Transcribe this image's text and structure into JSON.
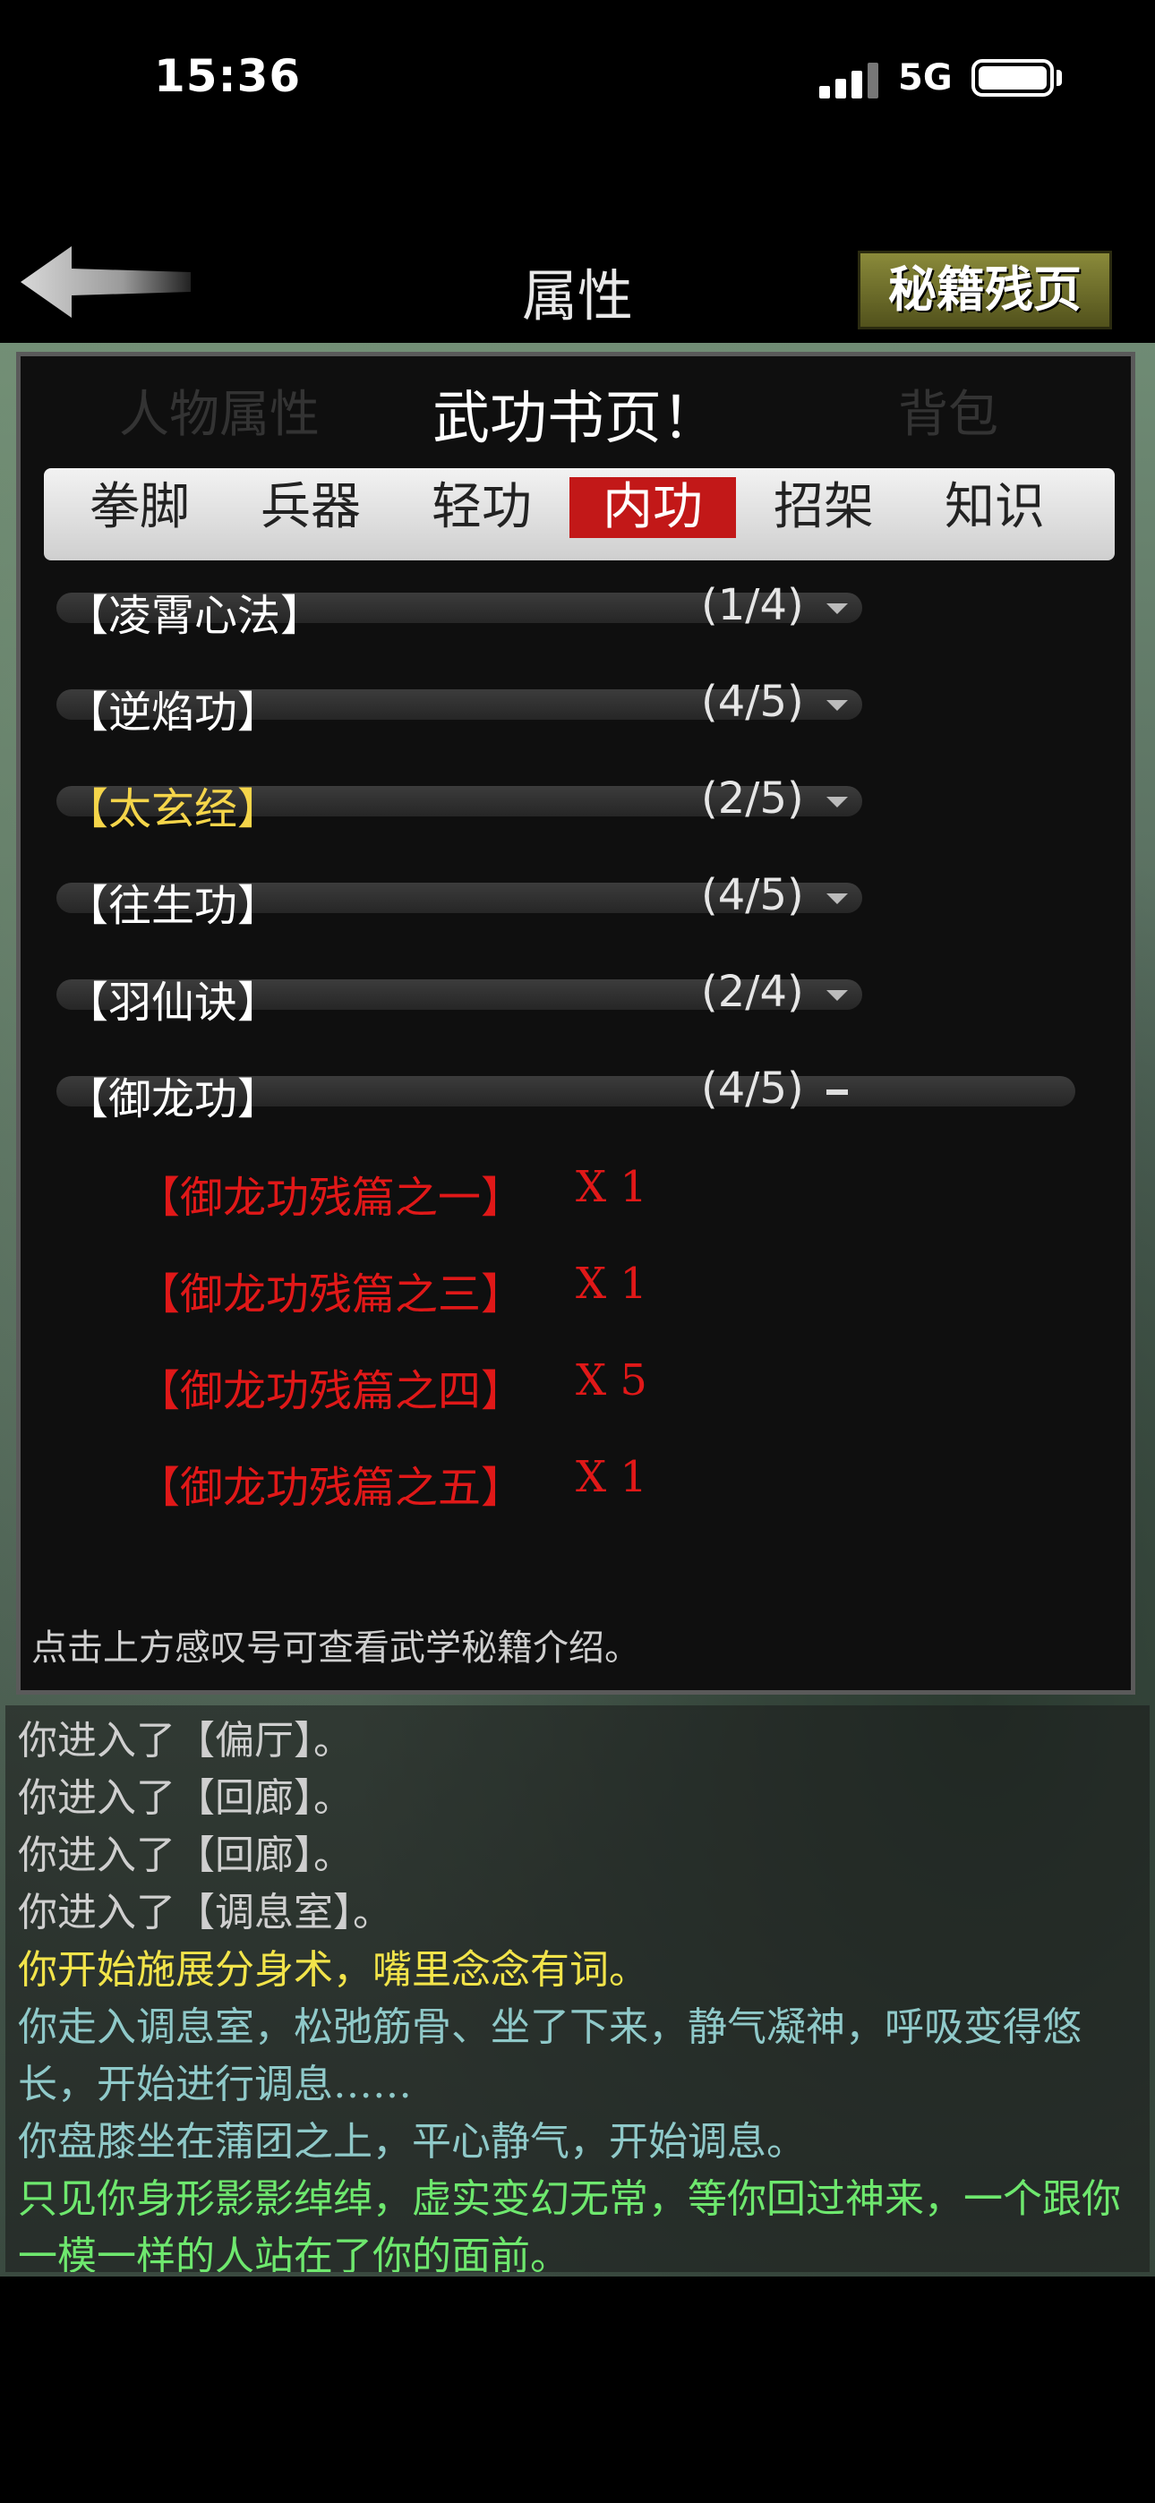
{
  "status_bar": {
    "time": "15:36",
    "network": "5G",
    "battery_level": 1.0
  },
  "nav": {
    "title": "属性",
    "scroll_button": "秘籍残页"
  },
  "panel": {
    "title": "武功书页！",
    "tabs": [
      {
        "label": "拳脚",
        "active": false
      },
      {
        "label": "兵器",
        "active": false
      },
      {
        "label": "轻功",
        "active": false
      },
      {
        "label": "内功",
        "active": true
      },
      {
        "label": "招架",
        "active": false
      },
      {
        "label": "知识",
        "active": false
      }
    ],
    "skills": [
      {
        "name": "【凌霄心法】",
        "count": "(1/4)",
        "highlight": false,
        "expanded": false
      },
      {
        "name": "【逆焰功】",
        "count": "(4/5)",
        "highlight": false,
        "expanded": false
      },
      {
        "name": "【太玄经】",
        "count": "(2/5)",
        "highlight": true,
        "expanded": false
      },
      {
        "name": "【往生功】",
        "count": "(4/5)",
        "highlight": false,
        "expanded": false
      },
      {
        "name": "【羽仙诀】",
        "count": "(2/4)",
        "highlight": false,
        "expanded": false
      },
      {
        "name": "【御龙功】",
        "count": "(4/5)",
        "highlight": false,
        "expanded": true
      }
    ],
    "fragments": [
      {
        "name": "【御龙功残篇之一】",
        "qty": "X 1"
      },
      {
        "name": "【御龙功残篇之三】",
        "qty": "X 1"
      },
      {
        "name": "【御龙功残篇之四】",
        "qty": "X 5"
      },
      {
        "name": "【御龙功残篇之五】",
        "qty": "X 1"
      }
    ],
    "hint": "点击上方感叹号可查看武学秘籍介绍。"
  },
  "log": [
    {
      "text": "你进入了【偏厅】。",
      "color": "#cfcfcf"
    },
    {
      "text": "你进入了【回廊】。",
      "color": "#cfcfcf"
    },
    {
      "text": "你进入了【回廊】。",
      "color": "#cfcfcf"
    },
    {
      "text": "你进入了【调息室】。",
      "color": "#cfcfcf"
    },
    {
      "text": "你开始施展分身术，嘴里念念有词。",
      "color": "#f2e44a"
    },
    {
      "text": "你走入调息室，松弛筋骨、坐了下来，静气凝神，呼吸变得悠长，开始进行调息……",
      "color": "#8fc9c9"
    },
    {
      "text": "你盘膝坐在蒲团之上，平心静气，开始调息。",
      "color": "#8fc9c9"
    },
    {
      "text": "只见你身形影影绰绰，虚实变幻无常，等你回过神来，一个跟你一模一样的人站在了你的面前。",
      "color": "#6ee86e"
    }
  ],
  "colors": {
    "accent_tab": "#c21818",
    "fragment_red": "#e01818",
    "highlight_gold": "#f5d54a"
  }
}
